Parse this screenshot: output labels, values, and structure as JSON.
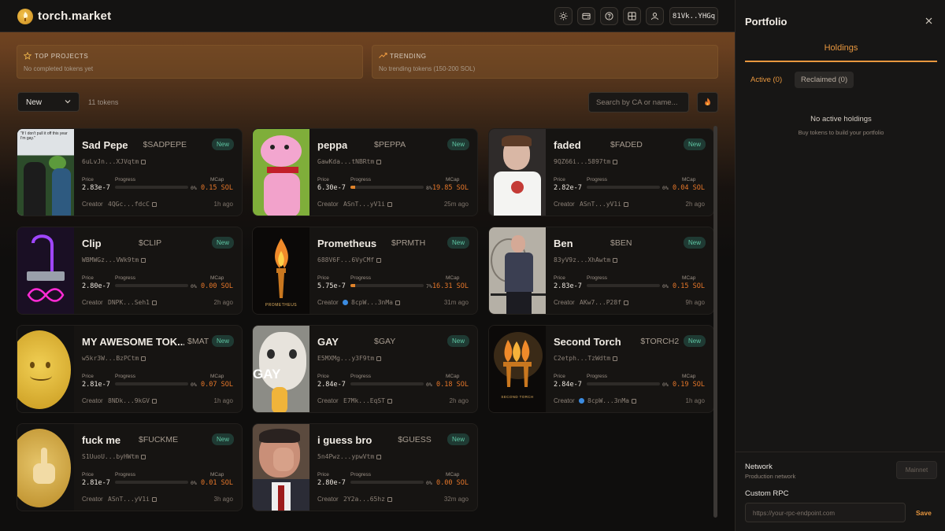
{
  "app": {
    "brand": "torch.market",
    "wallet": "81Vk..YHGq"
  },
  "topbar_icons": [
    "sun-icon",
    "wallet-icon",
    "help-icon",
    "grid-icon",
    "user-icon"
  ],
  "panels": {
    "top_projects": {
      "title": "TOP PROJECTS",
      "subtitle": "No completed tokens yet"
    },
    "trending": {
      "title": "TRENDING",
      "subtitle": "No trending tokens (150-200 SOL)"
    }
  },
  "toolbar": {
    "sort_value": "New",
    "token_count": "11 tokens",
    "search_placeholder": "Search by CA or name..."
  },
  "card_labels": {
    "price": "Price",
    "progress": "Progress",
    "mcap": "MCap",
    "creator": "Creator",
    "new": "New"
  },
  "tokens": [
    {
      "name": "Sad Pepe",
      "symbol": "$SADPEPE",
      "address": "6uLvJn...XJVqtm",
      "price": "2.83e-7",
      "progress": 0,
      "progress_label": "0%",
      "mcap": "0.15 SOL",
      "creator": "4QGc...fdcC",
      "verified": false,
      "ago": "1h ago"
    },
    {
      "name": "peppa",
      "symbol": "$PEPPA",
      "address": "GawKda...tNBRtm",
      "price": "6.30e-7",
      "progress": 8,
      "progress_label": "8%",
      "mcap": "19.85 SOL",
      "creator": "ASnT...yV1i",
      "verified": false,
      "ago": "25m ago"
    },
    {
      "name": "faded",
      "symbol": "$FADED",
      "address": "9QZ66i...5897tm",
      "price": "2.82e-7",
      "progress": 0,
      "progress_label": "0%",
      "mcap": "0.04 SOL",
      "creator": "ASnT...yV1i",
      "verified": false,
      "ago": "2h ago"
    },
    {
      "name": "Clip",
      "symbol": "$CLIP",
      "address": "WBMWGz...VWk9tm",
      "price": "2.80e-7",
      "progress": 0,
      "progress_label": "0%",
      "mcap": "0.00 SOL",
      "creator": "DNPK...Seh1",
      "verified": false,
      "ago": "2h ago"
    },
    {
      "name": "Prometheus",
      "symbol": "$PRMTH",
      "address": "688V6F...6VyCMf",
      "price": "5.75e-7",
      "progress": 7,
      "progress_label": "7%",
      "mcap": "16.31 SOL",
      "creator": "8cpW...3nMa",
      "verified": true,
      "ago": "31m ago"
    },
    {
      "name": "Ben",
      "symbol": "$BEN",
      "address": "83yV9z...XhAwtm",
      "price": "2.83e-7",
      "progress": 0,
      "progress_label": "0%",
      "mcap": "0.15 SOL",
      "creator": "AKw7...P28f",
      "verified": false,
      "ago": "9h ago"
    },
    {
      "name": "MY AWESOME TOK...",
      "symbol": "$MAT",
      "address": "w5kr3W...BzPCtm",
      "price": "2.81e-7",
      "progress": 0,
      "progress_label": "0%",
      "mcap": "0.07 SOL",
      "creator": "8NDk...9kGV",
      "verified": false,
      "ago": "1h ago"
    },
    {
      "name": "GAY",
      "symbol": "$GAY",
      "address": "E5MXMg...y3F9tm",
      "price": "2.84e-7",
      "progress": 0,
      "progress_label": "0%",
      "mcap": "0.18 SOL",
      "creator": "E7Mk...EqST",
      "verified": false,
      "ago": "2h ago"
    },
    {
      "name": "Second Torch",
      "symbol": "$TORCH2",
      "address": "C2etph...TzWdtm",
      "price": "2.84e-7",
      "progress": 0,
      "progress_label": "0%",
      "mcap": "0.19 SOL",
      "creator": "8cpW...3nMa",
      "verified": true,
      "ago": "1h ago"
    },
    {
      "name": "fuck me",
      "symbol": "$FUCKME",
      "address": "S1UuoU...byHWtm",
      "price": "2.81e-7",
      "progress": 0,
      "progress_label": "0%",
      "mcap": "0.01 SOL",
      "creator": "ASnT...yV1i",
      "verified": false,
      "ago": "3h ago"
    },
    {
      "name": "i guess bro",
      "symbol": "$GUESS",
      "address": "5n4Pwz...ypwVtm",
      "price": "2.80e-7",
      "progress": 0,
      "progress_label": "0%",
      "mcap": "0.00 SOL",
      "creator": "2Y2a...65hz",
      "verified": false,
      "ago": "32m ago"
    }
  ],
  "thumb_text": {
    "sadpepe": "\"If I don't pull it off this year I'm gay.\"",
    "prometheus": "PROMETHEUS",
    "gay": "GAY",
    "torch2": "SECOND TORCH"
  },
  "sidebar": {
    "title": "Portfolio",
    "tab": "Holdings",
    "active_label": "Active (0)",
    "reclaimed_label": "Reclaimed (0)",
    "empty_title": "No active holdings",
    "empty_sub": "Buy tokens to build your portfolio",
    "network_label": "Network",
    "network_sub": "Production network",
    "network_button": "Mainnet",
    "rpc_label": "Custom RPC",
    "rpc_placeholder": "https://your-rpc-endpoint.com",
    "save": "Save"
  },
  "colors": {
    "accent": "#e8973f",
    "mcap": "#e6772a",
    "new_badge": "#5fc7a4",
    "verified": "#3b8be0"
  }
}
